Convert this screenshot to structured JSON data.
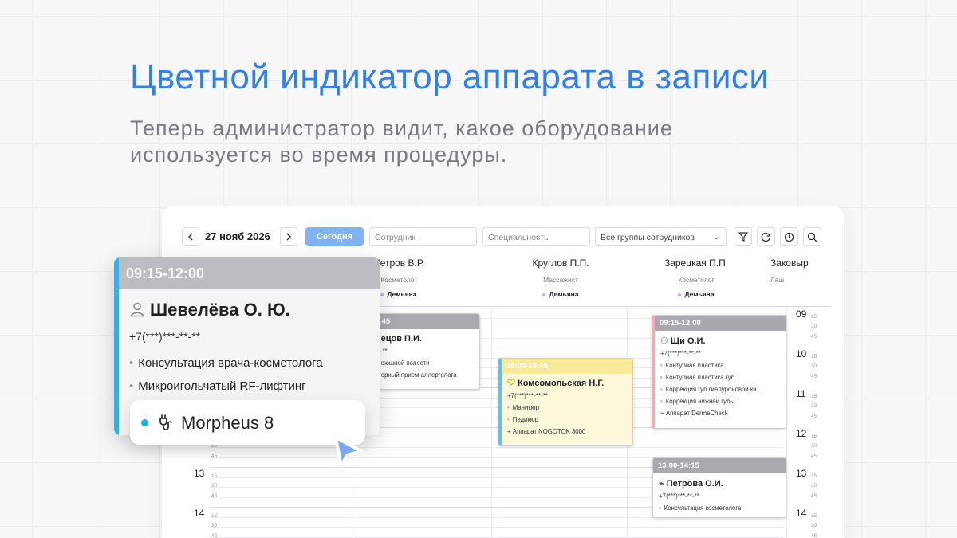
{
  "headline": "Цветной индикатор аппарата в записи",
  "subline": "Теперь администратор видит, какое оборудование используется во время процедуры.",
  "colors": {
    "accent": "#2f80ed",
    "today_button": "#7fb3f2",
    "device_indicator": "#1ab0ef"
  },
  "toolbar": {
    "prev_icon": "chevron-left-icon",
    "date": "27 нояб 2026",
    "next_icon": "chevron-right-icon",
    "today_label": "Сегодня",
    "employee_placeholder": "Сотрудник",
    "specialty_placeholder": "Специальность",
    "groups_value": "Все группы сотрудников",
    "icons": [
      "filter-icon",
      "refresh-icon",
      "clock-icon",
      "search-icon"
    ]
  },
  "staff": [
    {
      "name": "Петров В.Р.",
      "role": "Косметолог",
      "room": "Демьяна"
    },
    {
      "name": "Круглов  П.П.",
      "role": "Массажист",
      "room": "Демьяна"
    },
    {
      "name": "Зарецкая  П.П.",
      "role": "Косметолог",
      "room": "Демьяна"
    },
    {
      "name": "Заковыр",
      "role": "Лаш",
      "room": ""
    }
  ],
  "hours": {
    "left": [
      "13",
      "14"
    ],
    "right": [
      "09",
      "10",
      "11",
      "12",
      "13",
      "14"
    ]
  },
  "minute_marks": [
    "15",
    "30",
    "45"
  ],
  "cards": {
    "c1": {
      "time": "0:45",
      "name": "нецов П.И.",
      "phone": "-*-**",
      "services": [
        "оюшной полости",
        "орный прием аллерголога"
      ]
    },
    "c2": {
      "time": "15:00-16:45",
      "name": "Комсомольская Н.Г.",
      "phone": "+7(***)***-**-**",
      "services": [
        "Маникюр",
        "Педикюр"
      ],
      "device": "Аппарат NOGOTOK 3000"
    },
    "c3": {
      "time": "09:15-12:00",
      "name": "Щи О.И.",
      "phone": "+7(***)***-**-**",
      "services": [
        "Контурная пластика",
        "Контурная пластика губ",
        "Коррекция губ гиалуроновой ки...",
        "Коррекция нижней губы"
      ],
      "device": "Аппарат DermaCheck"
    },
    "c4": {
      "time": "13:00-14:15",
      "name": "Петрова О.И.",
      "phone": "+7(***)***-**-**",
      "services": [
        "Консультация косметолога"
      ]
    }
  },
  "popup": {
    "time": "09:15-12:00",
    "name": "Шевелёва О. Ю.",
    "phone": "+7(***)***-**-**",
    "services": [
      "Консультация врача-косметолога",
      "Микроигольчатый RF-лифтинг"
    ],
    "device": "Morpheus 8"
  }
}
